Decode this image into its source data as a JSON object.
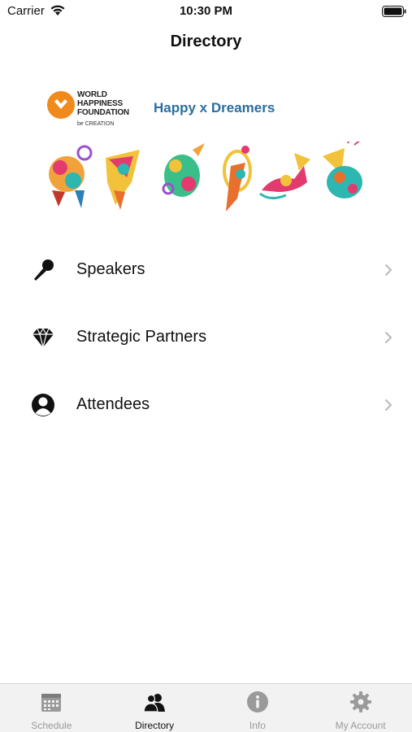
{
  "status_bar": {
    "carrier": "Carrier",
    "time": "10:30 PM"
  },
  "nav": {
    "title": "Directory"
  },
  "banner": {
    "logo_lines": [
      "WORLD",
      "HAPPINESS",
      "FOUNDATION"
    ],
    "logo_sub": "be CREATION",
    "tagline": "Happy x Dreamers",
    "colors": {
      "logo_orange": "#f08a1c",
      "tagline_blue": "#2a6e9e"
    }
  },
  "directory": {
    "items": [
      {
        "label": "Speakers",
        "icon": "microphone-icon"
      },
      {
        "label": "Strategic Partners",
        "icon": "diamond-icon"
      },
      {
        "label": "Attendees",
        "icon": "user-circle-icon"
      }
    ]
  },
  "tab_bar": {
    "active": "Directory",
    "tabs": [
      {
        "label": "Schedule",
        "icon": "calendar-icon"
      },
      {
        "label": "Directory",
        "icon": "people-icon"
      },
      {
        "label": "Info",
        "icon": "info-icon"
      },
      {
        "label": "My Account",
        "icon": "gear-icon"
      }
    ]
  }
}
